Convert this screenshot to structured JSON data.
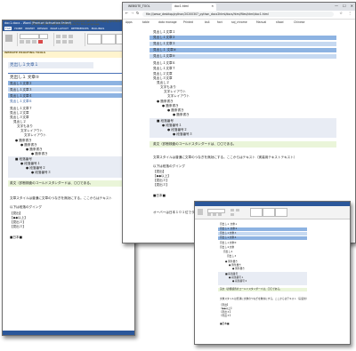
{
  "word": {
    "title": "doc1.docx - Word (Product Activation Failed)",
    "tabs": [
      "FILE",
      "HOME",
      "INSERT",
      "DESIGN",
      "PAGE LAYOUT",
      "REFERENCES",
      "MAILINGS"
    ],
    "message_label": "WEBSITE PROOFING TOOLS",
    "message_text": "This document contains text in Japanese which isn't being proofed. You may be able to get proofing tools for this language.",
    "doc_lines": [
      "見出し１文章１",
      "見出し１ 文章⑤",
      "見出し１文章２",
      "見出し１文章３",
      "見出し１文章４",
      "見出し１文章６",
      "見出し１文章７",
      "見出し２文章",
      "見出し３文章",
      "見出し２",
      "見出し２ 文章",
      "見出し３ 文章",
      "見出し３文章",
      "文字もあり",
      "文字レイアウト",
      "文字レイアウト",
      "文字レイアウト"
    ],
    "bullets": [
      "箇条書き",
      "箇条書き",
      "箇条書き",
      "箇条書き"
    ],
    "numbered": [
      "段落番号",
      "段落番号１",
      "段落番号２",
      "段落番号３"
    ],
    "note": "英文（診断検査のコールドスタンダードは、〇〇である。",
    "body1": "文章スタイルは普通に文章のつなぎを無効にする。ここからはテキスト",
    "body2": "以下は段落のグイング",
    "list_items": [
      "【見出】",
      "【◆◆以上】",
      "【見出３】",
      "【見出３】"
    ],
    "body_end": "■日本■"
  },
  "chrome": {
    "tab1": "WEBSITE_TOOL",
    "tab2": "doc1.html",
    "url": "file:///www_desktop/python/20200307_python_docx2html/docs/html/files/html/doc1.html",
    "bookmarks": [
      "Apps",
      "table",
      "data manage",
      "Printed",
      "bs4",
      "fact",
      "sql_chrome",
      "Manual",
      "sfood",
      "Chinese"
    ],
    "lines": [
      "見出し１文章１",
      "見出し１文章２",
      "見出し１文章３",
      "見出し１ 文章④",
      "見出し１文章⑤",
      "見出し１文章６",
      "見出し１文章７",
      "見出し２文章",
      "見出し３文章",
      "見出し２",
      "見出し２ 文章",
      "見出し３ 文章",
      "見出し３文章",
      "文字もあり",
      "文字レイアウト",
      "文字レイアウト"
    ],
    "bullets": [
      "箇条書き",
      "箇条書き",
      "箇条書き",
      "箇条書き"
    ],
    "numbered": [
      "段落番号",
      "段落番号１",
      "段落番号２",
      "段落番号３"
    ],
    "note": "英文（診断検査のコールドスタンダードは、〇〇である。",
    "body1": "文章スタイルは普通に文章のつなぎを無効にする。ここからはテキスト（実装用テキストテキスト）",
    "body2": "以下は段落のグイング",
    "list_items": [
      "【見出】",
      "【◆◆以上】",
      "【見出３】",
      "【見出３】"
    ],
    "body_end": "■日本■",
    "footer": "オーバーは日本１０１位でダウンロード"
  },
  "small": {
    "lines": [
      "見出し１ 文章１",
      "見出し１ 文章２",
      "見出し１文章３",
      "見出し１文章４",
      "見出し１文章⑤",
      "見出し２文章",
      "見出し２",
      "見出し３"
    ],
    "note": "英文（診断検査のコールドスタンダードは、〇〇である。",
    "body1": "文章スタイルは普通に文章のつなぎを無効にする。ここからはテキスト（実装用）",
    "list_items": [
      "【見出】",
      "【◆◆以上】",
      "【見出３】",
      "【見出３】"
    ],
    "body_end": "■日本■"
  },
  "colors": {
    "word_blue": "#2b579a",
    "heading_band": "#c6d9f1",
    "note_band": "#eaf5d9"
  }
}
